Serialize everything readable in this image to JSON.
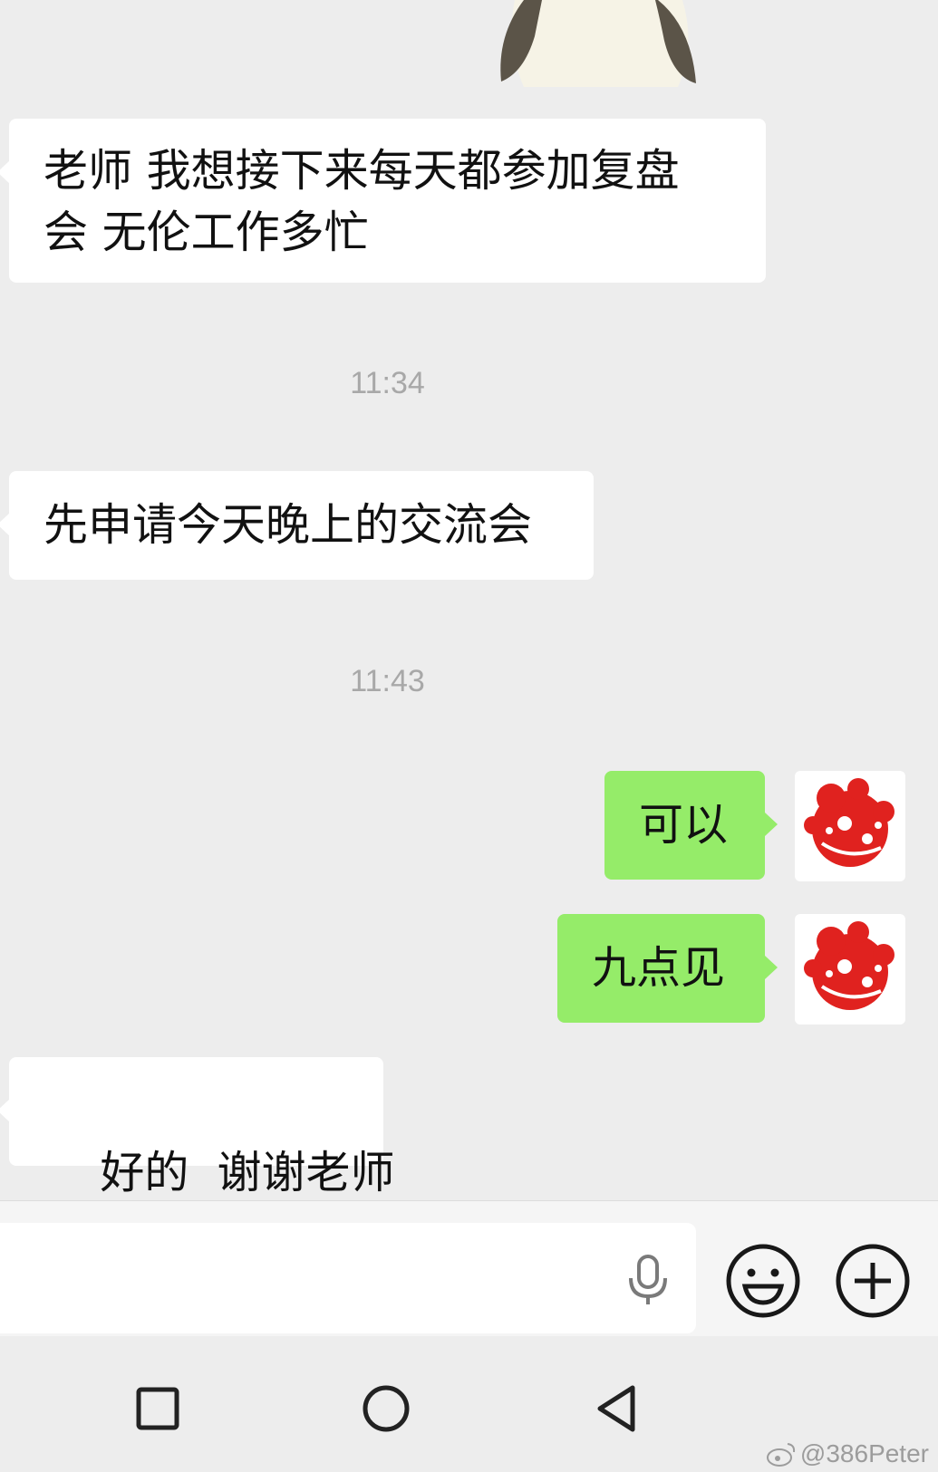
{
  "messages": [
    {
      "side": "in",
      "text_line1": "老师 我想接下来每天都参加复盘",
      "text_line2": "会 无伦工作多忙"
    },
    {
      "timestamp": "11:34"
    },
    {
      "side": "in",
      "text": "先申请今天晚上的交流会"
    },
    {
      "timestamp": "11:43"
    },
    {
      "side": "out",
      "text": "可以"
    },
    {
      "side": "out",
      "text": "九点见"
    },
    {
      "side": "in",
      "text": "好的  谢谢老师"
    }
  ],
  "colors": {
    "incoming": "#ffffff",
    "outgoing": "#95ec69",
    "background": "#ededed",
    "timestamp": "#a8a8a8"
  },
  "input": {
    "placeholder": ""
  },
  "icons": {
    "mic": "microphone-icon",
    "emoji": "smiley-icon",
    "plus": "plus-circle-icon"
  },
  "nav": {
    "recent": "square-icon",
    "home": "circle-icon",
    "back": "triangle-back-icon"
  },
  "watermark": "@386Peter"
}
